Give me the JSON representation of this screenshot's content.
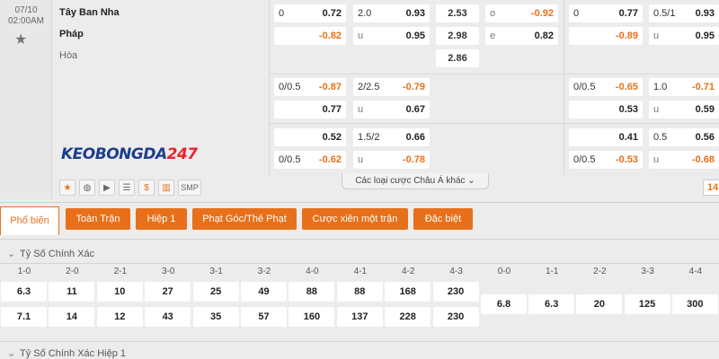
{
  "match": {
    "date": "07/10",
    "time": "02:00AM",
    "home": "Tây Ban Nha",
    "away": "Pháp",
    "draw": "Hòa",
    "logo_a": "KEOBONGDA",
    "logo_b": "247"
  },
  "odds": {
    "r1": {
      "a": [
        "0",
        "0.72"
      ],
      "b": [
        "2.0",
        "0.93"
      ],
      "c": "2.53",
      "d": [
        "o",
        "-0.92"
      ],
      "e": [
        "0",
        "0.77"
      ],
      "f": [
        "0.5/1",
        "0.93"
      ]
    },
    "r2": {
      "a": [
        "",
        "-0.82"
      ],
      "b": [
        "u",
        "0.95"
      ],
      "c": "2.98",
      "d": [
        "e",
        "0.82"
      ],
      "e": [
        "",
        "-0.89"
      ],
      "f": [
        "u",
        "0.95"
      ]
    },
    "r3": {
      "c": "2.86"
    },
    "r4": {
      "a": [
        "0/0.5",
        "-0.87"
      ],
      "b": [
        "2/2.5",
        "-0.79"
      ],
      "e": [
        "0/0.5",
        "-0.65"
      ],
      "f": [
        "1.0",
        "-0.71"
      ]
    },
    "r5": {
      "a": [
        "",
        "0.77"
      ],
      "b": [
        "u",
        "0.67"
      ],
      "e": [
        "",
        "0.53"
      ],
      "f": [
        "u",
        "0.59"
      ]
    },
    "r6": {
      "a": [
        "",
        "0.52"
      ],
      "b": [
        "1.5/2",
        "0.66"
      ],
      "e": [
        "",
        "0.41"
      ],
      "f": [
        "0.5",
        "0.56"
      ]
    },
    "r7": {
      "a": [
        "0/0.5",
        "-0.62"
      ],
      "b": [
        "u",
        "-0.78"
      ],
      "e": [
        "0/0.5",
        "-0.53"
      ],
      "f": [
        "u",
        "-0.68"
      ]
    }
  },
  "toolbar": {
    "smp_label": "SMP",
    "dollar_label": "$",
    "more_label": "Các loại cược Châu Á khác",
    "page_label": "14"
  },
  "tabs": {
    "active": "Phổ biến",
    "items": [
      "Toàn Trận",
      "Hiệp 1",
      "Phạt Góc/Thẻ Phạt",
      "Cược xiên một trận",
      "Đặc biệt"
    ]
  },
  "correct_score": {
    "title": "Tỷ Số Chính Xác",
    "home_scores": [
      "1-0",
      "2-0",
      "2-1",
      "3-0",
      "3-1",
      "3-2",
      "4-0",
      "4-1",
      "4-2",
      "4-3"
    ],
    "home_odds": [
      "6.3",
      "11",
      "10",
      "27",
      "25",
      "49",
      "88",
      "88",
      "168",
      "230"
    ],
    "away_odds": [
      "7.1",
      "14",
      "12",
      "43",
      "35",
      "57",
      "160",
      "137",
      "228",
      "230"
    ],
    "draw_scores": [
      "0-0",
      "1-1",
      "2-2",
      "3-3",
      "4-4"
    ],
    "draw_odds": [
      "6.8",
      "6.3",
      "20",
      "125",
      "300"
    ]
  },
  "half_score": {
    "title": "Tỷ Số Chính Xác Hiệp 1"
  },
  "colors": {
    "accent": "#e8701a",
    "negative": "#e8701a",
    "logo_blue": "#1c3e8c",
    "logo_red": "#e8242c"
  }
}
